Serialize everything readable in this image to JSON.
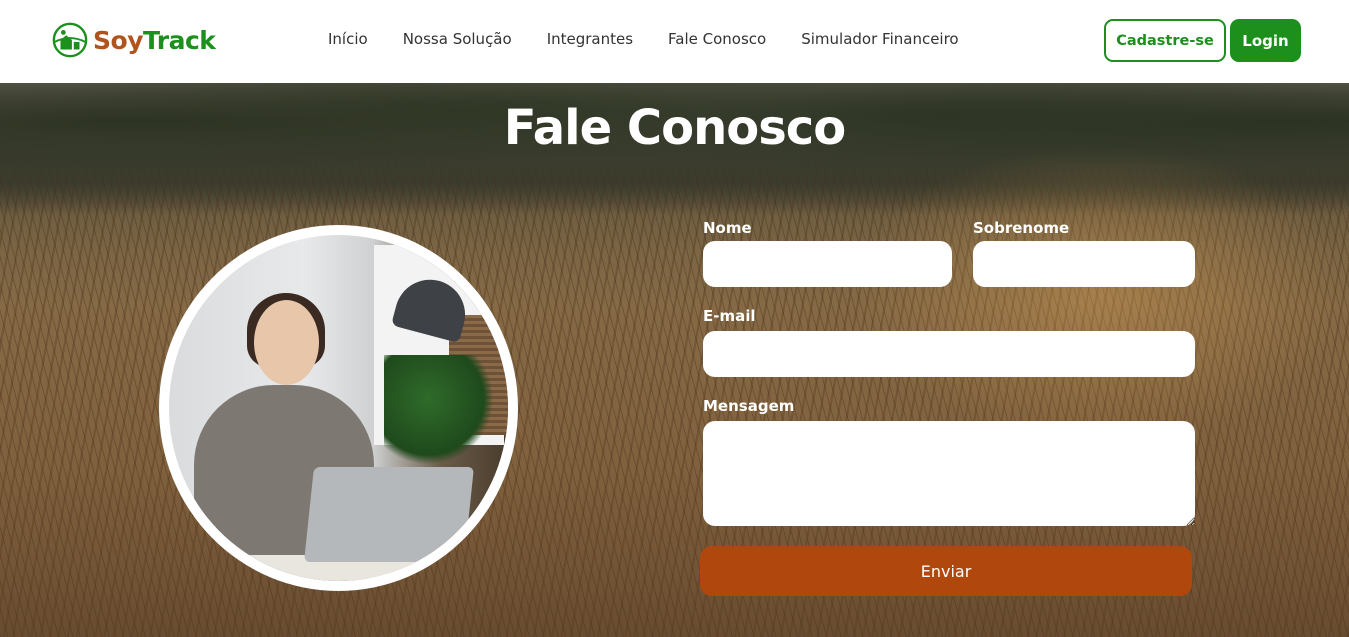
{
  "brand": {
    "part1": "So",
    "part2": "y",
    "part3": "Track",
    "colors": {
      "soy": "#b0531c",
      "track": "#1d8f1d"
    }
  },
  "nav": {
    "items": [
      {
        "label": "Início"
      },
      {
        "label": "Nossa Solução"
      },
      {
        "label": "Integrantes"
      },
      {
        "label": "Fale Conosco"
      },
      {
        "label": "Simulador Financeiro"
      }
    ]
  },
  "auth": {
    "signup_label": "Cadastre-se",
    "login_label": "Login"
  },
  "hero": {
    "title": "Fale Conosco"
  },
  "form": {
    "first_name_label": "Nome",
    "last_name_label": "Sobrenome",
    "email_label": "E-mail",
    "message_label": "Mensagem",
    "first_name_value": "",
    "last_name_value": "",
    "email_value": "",
    "message_value": "",
    "submit_label": "Enviar"
  },
  "colors": {
    "accent_green": "#1d8f1d",
    "submit_orange": "#b0470c"
  }
}
